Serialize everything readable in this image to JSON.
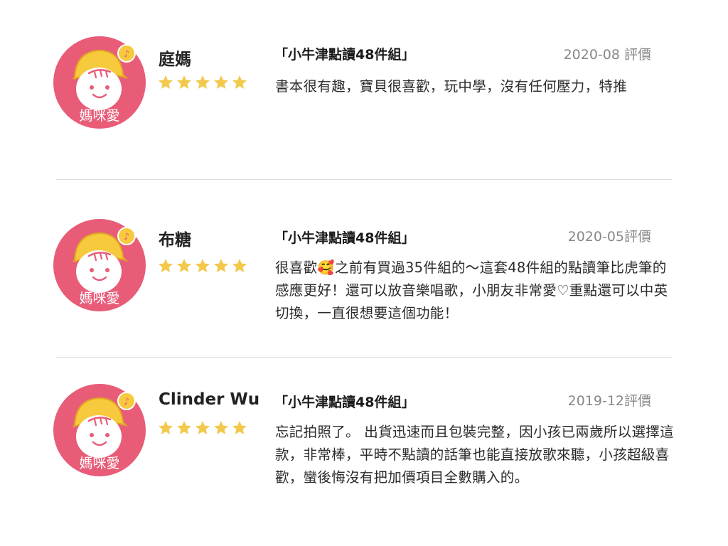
{
  "avatar": {
    "text": "媽咪愛",
    "bg": "#e85c78"
  },
  "colors": {
    "star": "#f2c94c",
    "divider": "#dddddd",
    "date": "#888888"
  },
  "reviews": [
    {
      "name": "庭媽",
      "rating": 5,
      "product": "「小牛津點讀48件組」",
      "date": "2020-08 評價",
      "comment": "書本很有趣，寶貝很喜歡，玩中學，沒有任何壓力，特推"
    },
    {
      "name": "布糖",
      "rating": 5,
      "product": "「小牛津點讀48件組」",
      "date": "2020-05評價",
      "comment": "很喜歡🥰之前有買過35件組的～這套48件組的點讀筆比虎筆的感應更好！還可以放音樂唱歌，小朋友非常愛♡重點還可以中英切換，一直很想要這個功能！"
    },
    {
      "name": "Clinder Wu",
      "rating": 5,
      "product": "「小牛津點讀48件組」",
      "date": "2019-12評價",
      "comment": "忘記拍照了。 出貨迅速而且包裝完整，因小孩已兩歲所以選擇這款，非常棒，平時不點讀的話筆也能直接放歌來聽，小孩超級喜歡，蠻後悔沒有把加價項目全數購入的。"
    }
  ]
}
